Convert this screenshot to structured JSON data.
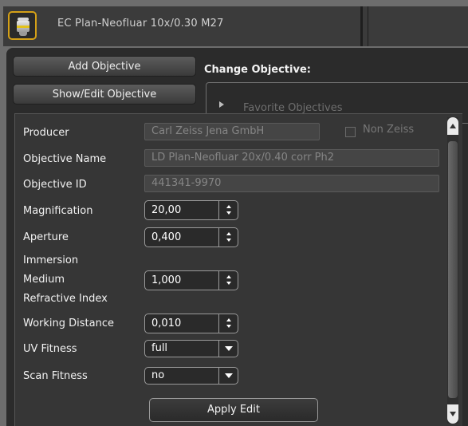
{
  "header": {
    "objective_title": "EC Plan-Neofluar 10x/0.30 M27"
  },
  "panel": {
    "add_objective_label": "Add Objective",
    "show_edit_label": "Show/Edit Objective",
    "change_objective_label": "Change Objective:",
    "favorite_objectives_label": "Favorite Objectives"
  },
  "edit": {
    "producer_label": "Producer",
    "producer_value": "Carl Zeiss Jena GmbH",
    "non_zeiss_label": "Non Zeiss",
    "objective_name_label": "Objective Name",
    "objective_name_value": "LD Plan-Neofluar 20x/0.40 corr Ph2",
    "objective_id_label": "Objective ID",
    "objective_id_value": "441341-9970",
    "magnification_label": "Magnification",
    "magnification_value": "20,00",
    "aperture_label": "Aperture",
    "aperture_value": "0,400",
    "immersion_label_line1": "Immersion",
    "immersion_label_line2": "Medium",
    "immersion_label_line3": "Refractive Index",
    "immersion_value": "1,000",
    "working_distance_label": "Working Distance",
    "working_distance_value": "0,010",
    "uv_fitness_label": "UV Fitness",
    "uv_fitness_value": "full",
    "scan_fitness_label": "Scan Fitness",
    "scan_fitness_value": "no",
    "apply_edit_label": "Apply Edit"
  },
  "colors": {
    "accent_gold": "#d4a017",
    "panel_bg": "#363636",
    "text_light": "#f2f2f2",
    "text_disabled": "#858585"
  }
}
